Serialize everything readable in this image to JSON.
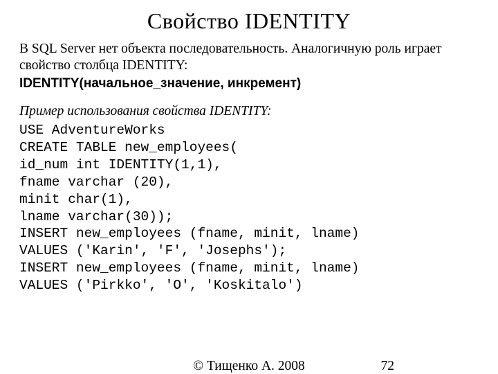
{
  "title": "Свойство IDENTITY",
  "intro": "В SQL Server нет объекта последовательность. Аналогичную роль играет свойство столбца IDENTITY:",
  "syntax": "IDENTITY(начальное_значение, инкремент)",
  "example_label": "Пример использования свойства IDENTITY:",
  "code": "USE AdventureWorks\nCREATE TABLE new_employees(\nid_num int IDENTITY(1,1),\nfname varchar (20),\nminit char(1),\nlname varchar(30));\nINSERT new_employees (fname, minit, lname)\nVALUES ('Karin', 'F', 'Josephs');\nINSERT new_employees (fname, minit, lname)\nVALUES ('Pirkko', 'O', 'Koskitalo')",
  "footer": {
    "copyright": "© Тищенко А. 2008",
    "page": "72"
  }
}
